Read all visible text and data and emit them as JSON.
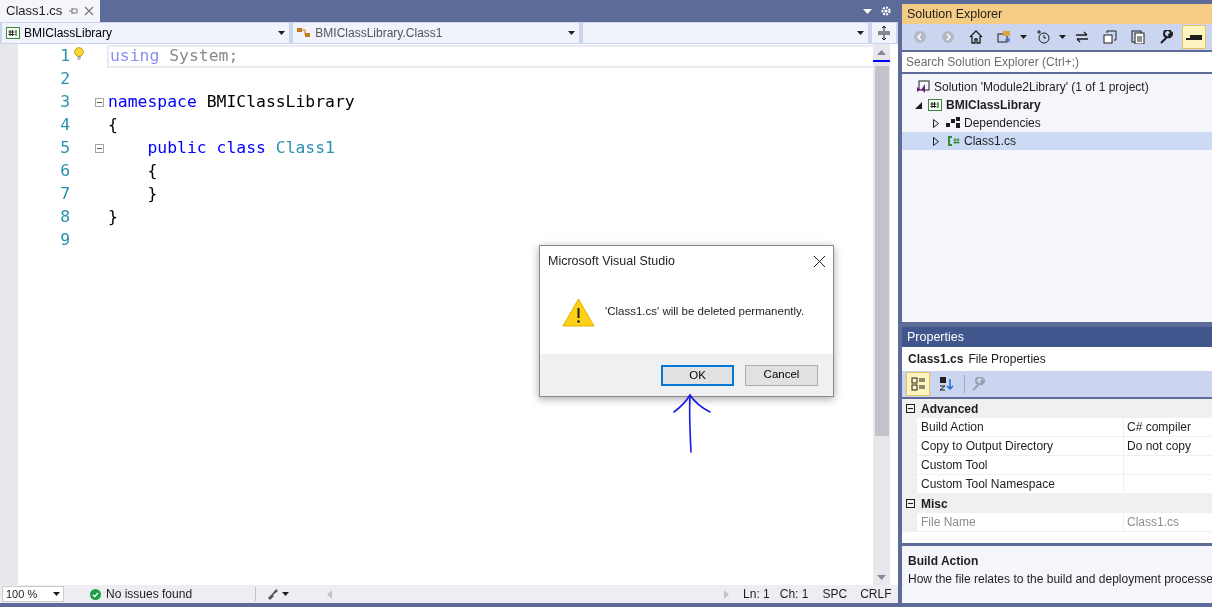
{
  "editor_tab": {
    "label": "Class1.cs",
    "selected": true
  },
  "navigation_bar": {
    "project": "BMIClassLibrary",
    "type": "BMIClassLibrary.Class1"
  },
  "code_lines": [
    {
      "number": "1",
      "current": true,
      "hint": true,
      "fold": false,
      "tokens": [
        {
          "text": "using",
          "kind": "unused-keyword"
        },
        {
          "text": " System;",
          "kind": "unused"
        }
      ]
    },
    {
      "number": "2",
      "current": false,
      "hint": false,
      "fold": false
    },
    {
      "number": "3",
      "current": false,
      "hint": false,
      "fold": true,
      "tokens": [
        {
          "text": "namespace",
          "kind": "keyword"
        },
        {
          "text": " BMIClassLibrary",
          "kind": "plain"
        }
      ]
    },
    {
      "number": "4",
      "current": false,
      "hint": false,
      "fold": false,
      "tokens": [
        {
          "text": "{",
          "kind": "plain"
        }
      ]
    },
    {
      "number": "5",
      "current": false,
      "hint": false,
      "fold": true,
      "tokens": [
        {
          "text": "    public class",
          "kind": "keyword"
        },
        {
          "text": " Class1",
          "kind": "type"
        }
      ]
    },
    {
      "number": "6",
      "current": false,
      "hint": false,
      "fold": false,
      "tokens": [
        {
          "text": "    {",
          "kind": "plain"
        }
      ]
    },
    {
      "number": "7",
      "current": false,
      "hint": false,
      "fold": false,
      "tokens": [
        {
          "text": "    }",
          "kind": "plain"
        }
      ]
    },
    {
      "number": "8",
      "current": false,
      "hint": false,
      "fold": false,
      "tokens": [
        {
          "text": "}",
          "kind": "plain"
        }
      ]
    },
    {
      "number": "9",
      "current": false,
      "hint": false,
      "fold": false
    }
  ],
  "status_bar": {
    "zoom": "100 %",
    "issues": "No issues found",
    "line": "Ln: 1",
    "column": "Ch: 1",
    "whitespace": "SPC",
    "line_endings": "CRLF"
  },
  "solution_explorer": {
    "title": "Solution Explorer",
    "preview_button": {
      "selected": true
    },
    "search": {
      "placeholder": "Search Solution Explorer (Ctrl+;)"
    },
    "solution": {
      "label": "Solution 'Module2Library' (1 of 1 project)",
      "selected": false
    },
    "projects": [
      {
        "label": "BMIClassLibrary",
        "kind": "project",
        "expanded": true,
        "selected": false,
        "children": [
          {
            "label": "Dependencies",
            "kind": "dependencies",
            "expanded": false,
            "selected": false
          },
          {
            "label": "Class1.cs",
            "kind": "csharp-file",
            "expanded": false,
            "selected": true
          }
        ]
      }
    ]
  },
  "properties": {
    "title": "Properties",
    "object_name": "Class1.cs",
    "object_type": "File Properties",
    "toolbar": [
      {
        "kind": "categorized",
        "selected": true
      },
      {
        "kind": "alphabetical",
        "selected": false
      }
    ],
    "categories": [
      {
        "name": "Advanced",
        "expanded": true,
        "rows": [
          {
            "name": "Build Action",
            "value": "C# compiler",
            "disabled": false
          },
          {
            "name": "Copy to Output Directory",
            "value": "Do not copy",
            "disabled": false
          },
          {
            "name": "Custom Tool",
            "disabled": false
          },
          {
            "name": "Custom Tool Namespace",
            "disabled": false
          }
        ]
      },
      {
        "name": "Misc",
        "expanded": true,
        "rows": [
          {
            "name": "File Name",
            "value": "Class1.cs",
            "disabled": true
          }
        ]
      }
    ],
    "description": {
      "title": "Build Action",
      "text": "How the file relates to the build and deployment processe"
    }
  },
  "dialog": {
    "title": "Microsoft Visual Studio",
    "message": "'Class1.cs' will be deleted permanently.",
    "buttons": [
      {
        "label": "OK",
        "default": true
      },
      {
        "label": "Cancel",
        "default": false
      }
    ]
  }
}
